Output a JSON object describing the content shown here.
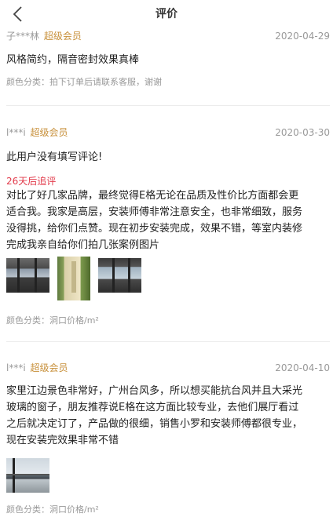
{
  "header": {
    "title": "评价",
    "back_icon": "chevron-left-icon"
  },
  "reviews": [
    {
      "username": "子***林",
      "member": "超级会员",
      "date": "2020-04-29",
      "content": "风格简约，隔音密封效果真棒",
      "meta": "颜色分类：拍下订单后请联系客服，谢谢"
    },
    {
      "username": "l***i",
      "member": "超级会员",
      "date": "2020-03-30",
      "content": "此用户没有填写评论!",
      "followup_label": "26天后追评",
      "followup_lines": [
        "对比了好几家品牌，最终觉得E格无论在品质及性价比方面都会更",
        "适合我。我家是高层，安装师傅非常注意安全，也非常细致，服务",
        "没得挑，给你们点赞。现在初步安装完成，效果不错，等室内装修",
        "完成我亲自给你们拍几张案例图片"
      ],
      "meta": "颜色分类：洞口价格/m²"
    },
    {
      "username": "l***i",
      "member": "超级会员",
      "date": "2020-04-10",
      "content_lines": [
        "家里江边景色非常好，广州台风多，所以想买能抗台风并且大采光",
        "玻璃的窗子，朋友推荐说E格在这方面比较专业，去他们展厅看过",
        "之后就决定订了，产品做的很细，销售小罗和安装师傅都很专业，",
        "现在安装完效果非常不错"
      ],
      "meta": "颜色分类：洞口价格/m²"
    }
  ]
}
